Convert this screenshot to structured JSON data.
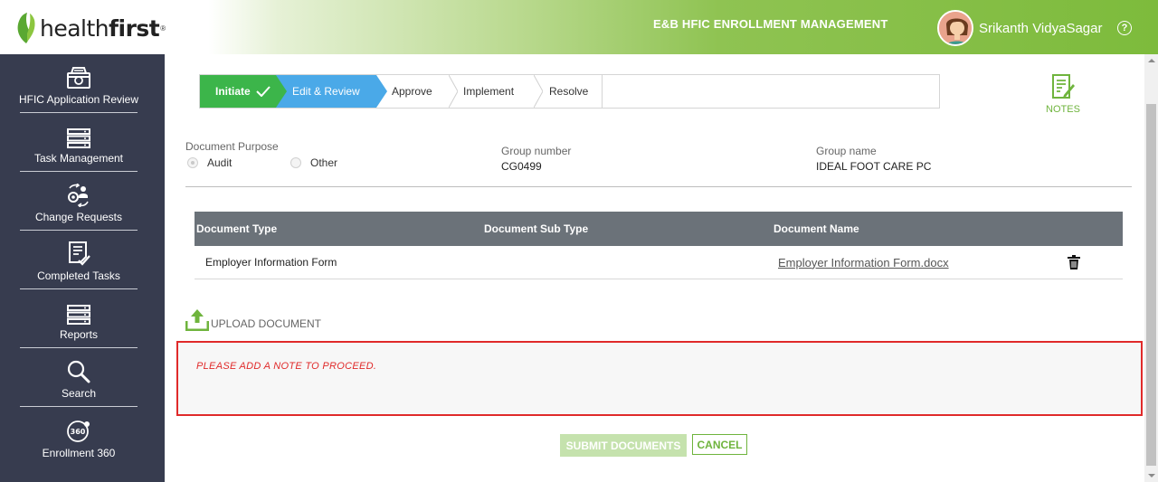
{
  "brand": {
    "logo_light": "health",
    "logo_bold": "first",
    "logo_mark": "®"
  },
  "header": {
    "title": "E&B HFIC ENROLLMENT MANAGEMENT",
    "user_name": "Srikanth VidyaSagar",
    "help_glyph": "?"
  },
  "sidebar": {
    "items": [
      {
        "label": "HFIC Application Review",
        "icon": "application-review-icon"
      },
      {
        "label": "Task Management",
        "icon": "server-stack-icon"
      },
      {
        "label": "Change Requests",
        "icon": "change-request-icon"
      },
      {
        "label": "Completed Tasks",
        "icon": "completed-tasks-icon"
      },
      {
        "label": "Reports",
        "icon": "server-stack-icon"
      },
      {
        "label": "Search",
        "icon": "search-icon"
      },
      {
        "label": "Enrollment 360",
        "icon": "enrollment-360-icon",
        "badge": "360"
      }
    ]
  },
  "stepper": {
    "steps": [
      {
        "label": "Initiate",
        "state": "done"
      },
      {
        "label": "Edit & Review",
        "state": "current"
      },
      {
        "label": "Approve",
        "state": "pending"
      },
      {
        "label": "Implement",
        "state": "pending"
      },
      {
        "label": "Resolve",
        "state": "pending"
      }
    ]
  },
  "notes": {
    "label": "NOTES"
  },
  "form": {
    "purpose_label": "Document Purpose",
    "purpose_options": [
      "Audit",
      "Other"
    ],
    "purpose_selected": "Audit",
    "group_number_label": "Group number",
    "group_number_value": "CG0499",
    "group_name_label": "Group name",
    "group_name_value": "IDEAL FOOT CARE PC"
  },
  "documents_table": {
    "headers": [
      "Document Type",
      "Document Sub Type",
      "Document Name"
    ],
    "rows": [
      {
        "type": "Employer Information Form",
        "sub_type": "",
        "name": "Employer Information Form.docx"
      }
    ]
  },
  "upload": {
    "label": "UPLOAD DOCUMENT"
  },
  "note": {
    "placeholder": "PLEASE ADD A NOTE TO PROCEED."
  },
  "actions": {
    "submit_label": "SUBMIT DOCUMENTS",
    "cancel_label": "CANCEL"
  },
  "colors": {
    "accent_green": "#6fb43d",
    "step_done": "#3cb54a",
    "step_current": "#4aa9e8",
    "sidebar_bg": "#373c4f",
    "error_red": "#e02a2a"
  }
}
